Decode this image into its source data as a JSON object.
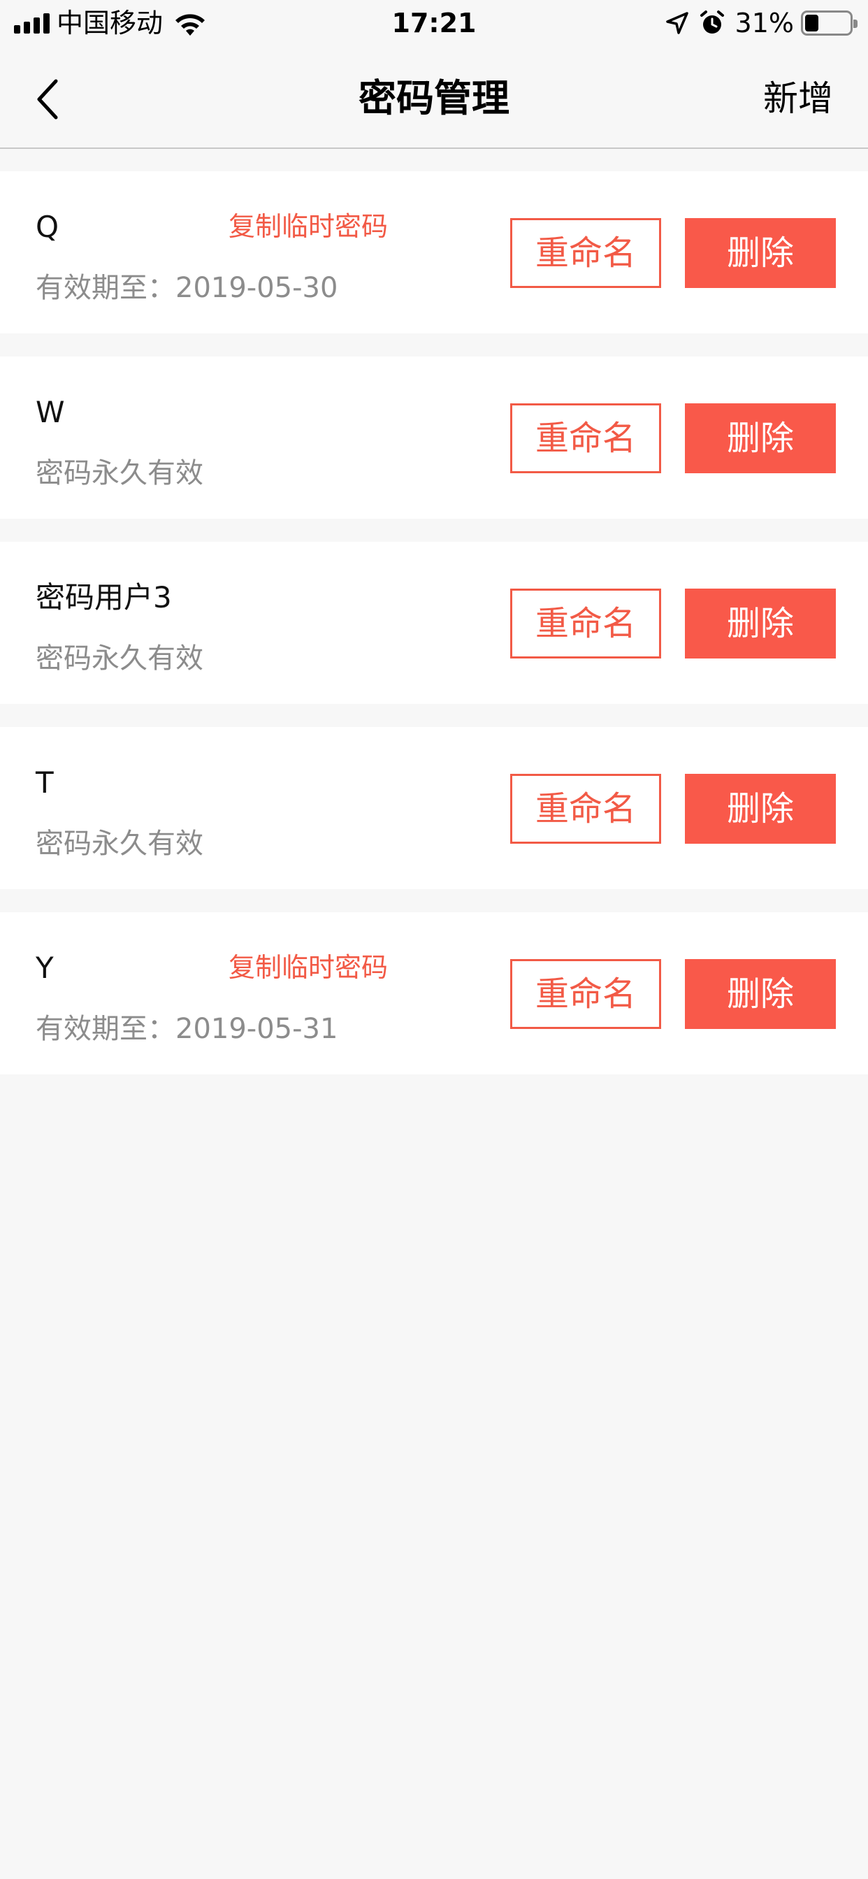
{
  "status_bar": {
    "carrier": "中国移动",
    "time": "17:21",
    "battery_text": "31%",
    "battery_level": 0.31
  },
  "nav": {
    "title": "密码管理",
    "add_label": "新增"
  },
  "items": [
    {
      "name": "Q",
      "copy_label": "复制临时密码",
      "validity": "有效期至：2019-05-30",
      "rename_label": "重命名",
      "delete_label": "删除"
    },
    {
      "name": "W",
      "copy_label": "",
      "validity": "密码永久有效",
      "rename_label": "重命名",
      "delete_label": "删除"
    },
    {
      "name": "密码用户3",
      "copy_label": "",
      "validity": "密码永久有效",
      "rename_label": "重命名",
      "delete_label": "删除"
    },
    {
      "name": "T",
      "copy_label": "",
      "validity": "密码永久有效",
      "rename_label": "重命名",
      "delete_label": "删除"
    },
    {
      "name": "Y",
      "copy_label": "复制临时密码",
      "validity": "有效期至：2019-05-31",
      "rename_label": "重命名",
      "delete_label": "删除"
    }
  ],
  "colors": {
    "accent": "#f25a46",
    "delete_bg": "#f9594a",
    "background": "#f7f7f7",
    "secondary_text": "#8c8c8c"
  }
}
